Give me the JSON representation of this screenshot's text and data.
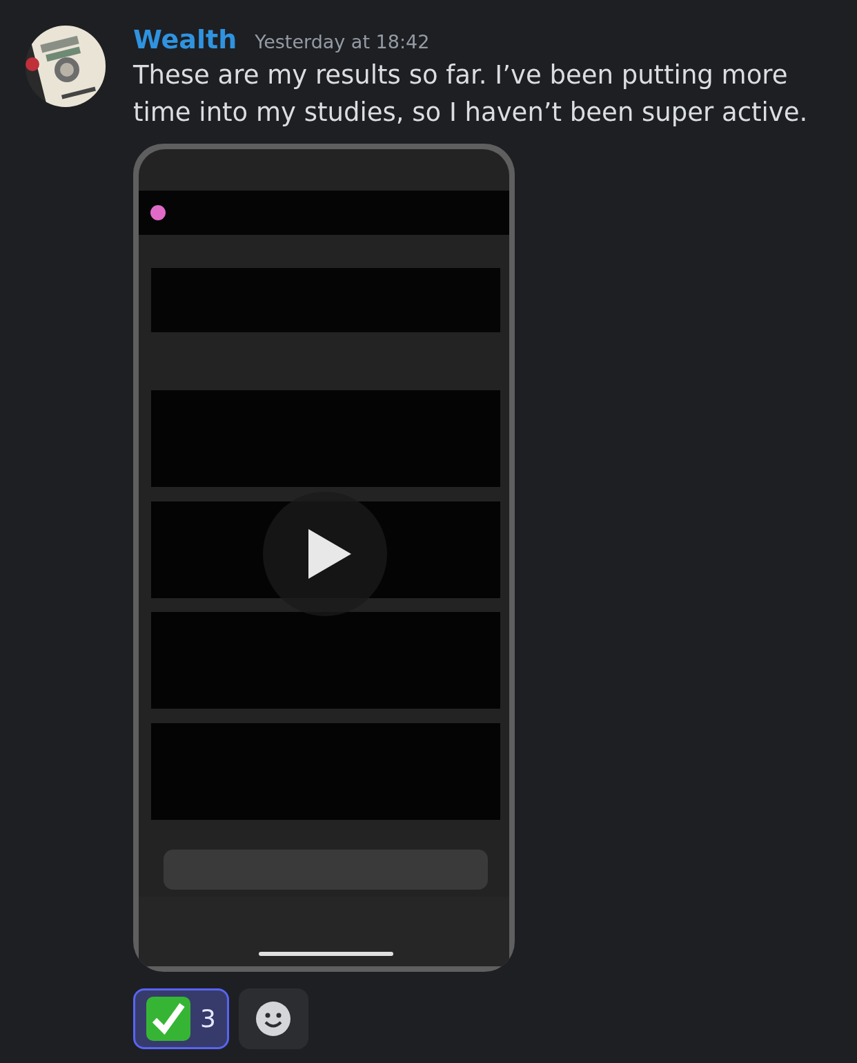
{
  "message": {
    "author": "Wealth",
    "timestamp": "Yesterday at 18:42",
    "text": "These are my results so far. I’ve been putting more time into my studies, so I haven’t been super active.",
    "attachment": {
      "kind": "video"
    }
  },
  "reactions": [
    {
      "count": "3",
      "selected": true
    }
  ]
}
